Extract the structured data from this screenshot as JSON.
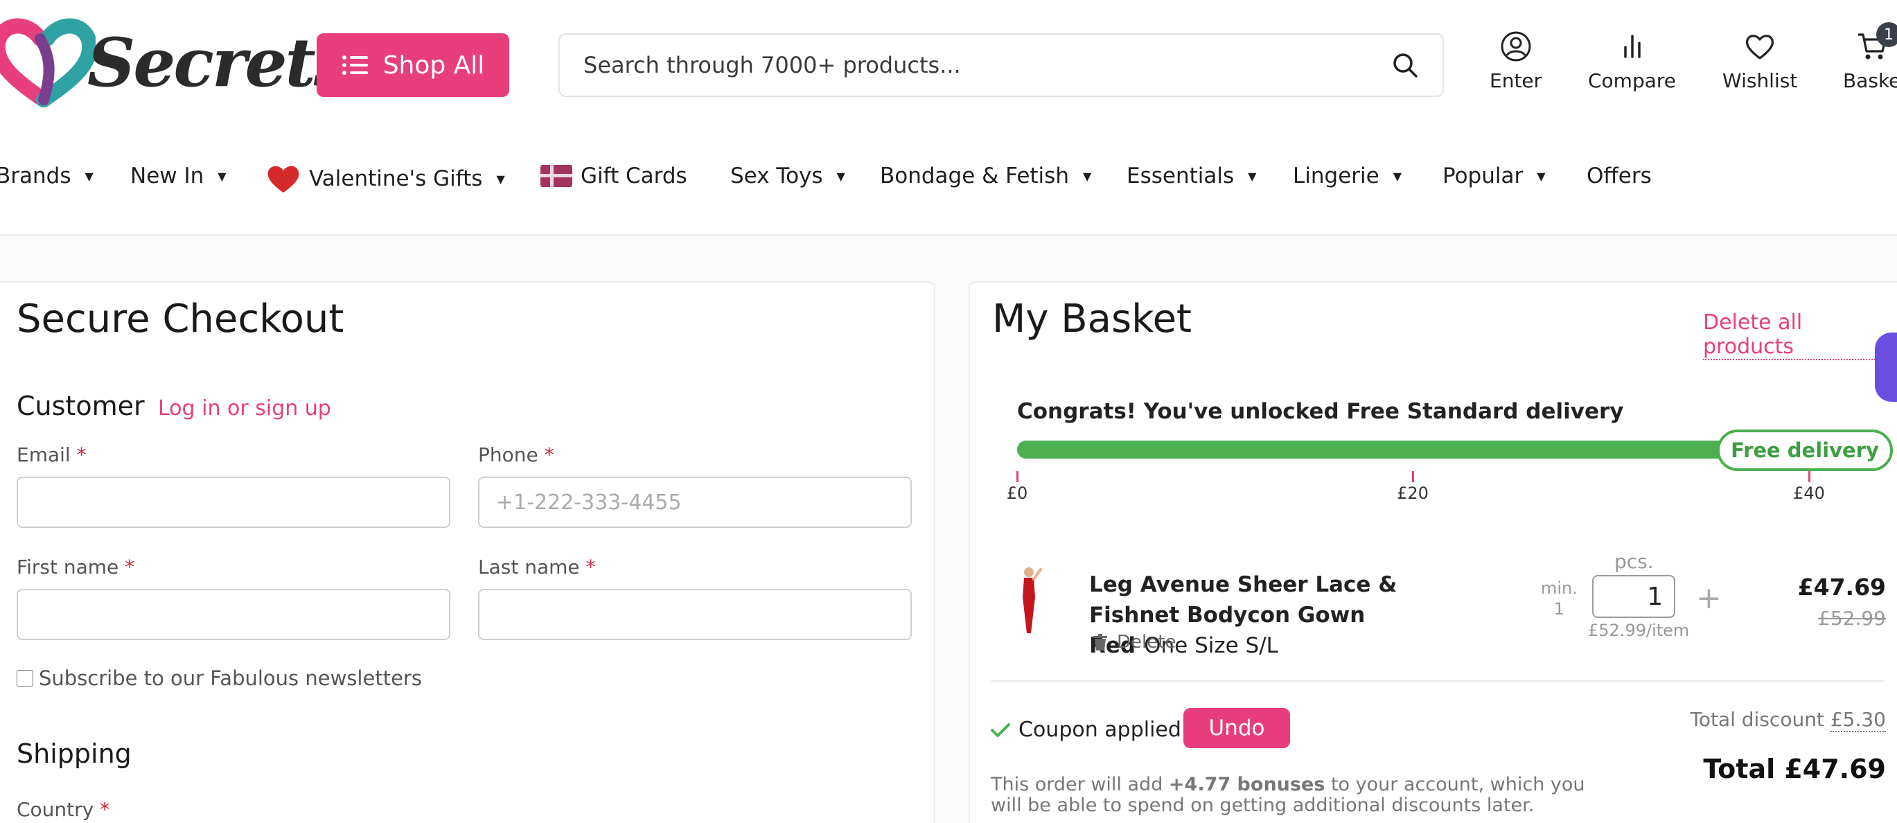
{
  "header": {
    "logo_text": "Secrets",
    "shop_all_label": "Shop All",
    "search_placeholder": "Search through 7000+ products...",
    "links": {
      "enter": "Enter",
      "compare": "Compare",
      "wishlist": "Wishlist",
      "basket": "Baske"
    },
    "cart_count": "1"
  },
  "nav": {
    "brands": "Brands",
    "new_in": "New In",
    "valentines": "Valentine's Gifts",
    "gift_cards": "Gift Cards",
    "sex_toys": "Sex Toys",
    "bondage": "Bondage & Fetish",
    "essentials": "Essentials",
    "lingerie": "Lingerie",
    "popular": "Popular",
    "offers": "Offers"
  },
  "checkout": {
    "title": "Secure Checkout",
    "customer_heading": "Customer",
    "login_link": "Log in or sign up",
    "email_label": "Email",
    "phone_label": "Phone",
    "phone_placeholder": "+1-222-333-4455",
    "first_name_label": "First name",
    "last_name_label": "Last name",
    "required_mark": "*",
    "newsletter_label": "Subscribe to our Fabulous newsletters",
    "shipping_heading": "Shipping",
    "country_label": "Country"
  },
  "basket": {
    "title": "My Basket",
    "delete_all": "Delete all products",
    "congrats": "Congrats! You've unlocked Free Standard delivery",
    "free_delivery_badge": "Free delivery",
    "progress_fraction": 1.0,
    "ticks": [
      "£0",
      "£20",
      "£40"
    ],
    "item": {
      "name": "Leg Avenue Sheer Lace & Fishnet Bodycon Gown Red",
      "size": "One Size S/L",
      "delete_label": "Delete",
      "min_label": "min.",
      "min_value": "1",
      "pcs_label": "pcs.",
      "quantity": "1",
      "per_item": "£52.99/item",
      "price": "£47.69",
      "old_price": "£52.99"
    },
    "coupon_label": "Coupon applied",
    "undo_label": "Undo",
    "total_discount_label": "Total discount",
    "total_discount_value": "£5.30",
    "total_label": "Total £47.69",
    "bonus_prefix": "This order will add",
    "bonus_amount": "+4.77 bonuses",
    "bonus_suffix": "to your account, which you will be able to spend on getting additional discounts later."
  },
  "colors": {
    "brand_pink": "#e83e7d",
    "progress_green": "#4caf50",
    "required_red": "#d0273d"
  }
}
